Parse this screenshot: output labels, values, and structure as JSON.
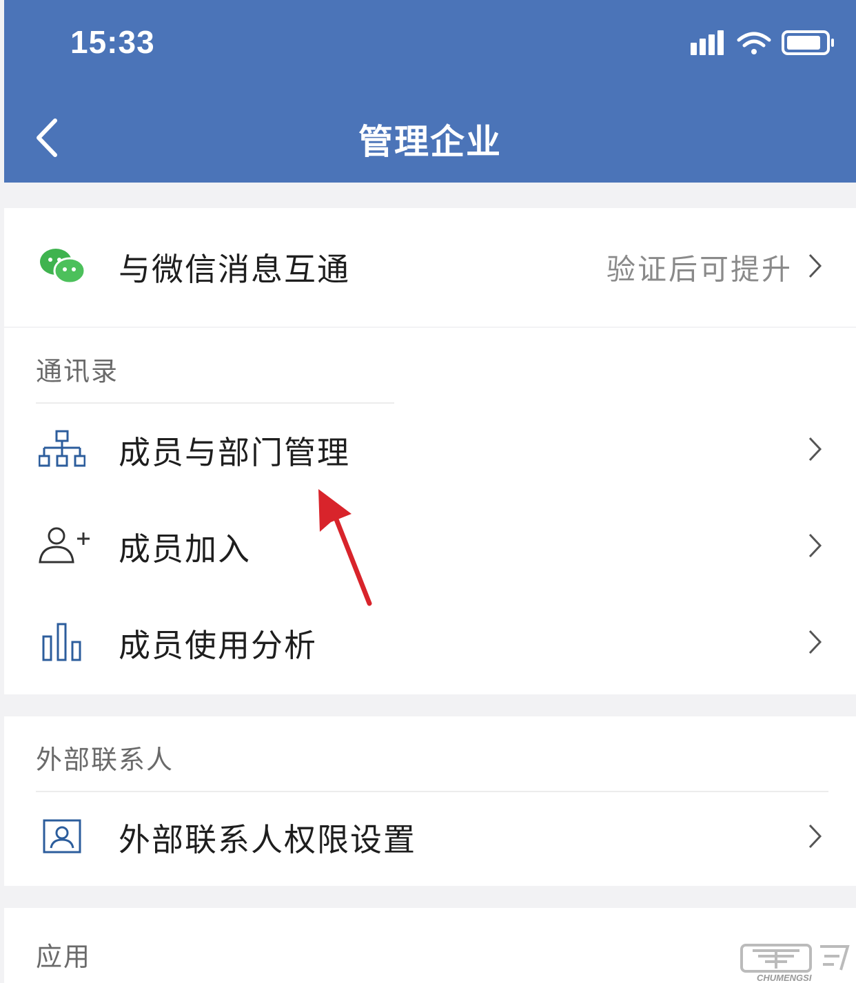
{
  "status_bar": {
    "time": "15:33"
  },
  "nav": {
    "title": "管理企业",
    "back_icon": "chevron-left-icon"
  },
  "wechat_row": {
    "label": "与微信消息互通",
    "value": "验证后可提升",
    "icon": "wechat-icon"
  },
  "sections": {
    "contacts": {
      "title": "通讯录",
      "items": [
        {
          "label": "成员与部门管理",
          "icon": "org-chart-icon"
        },
        {
          "label": "成员加入",
          "icon": "add-person-icon"
        },
        {
          "label": "成员使用分析",
          "icon": "bar-chart-icon"
        }
      ]
    },
    "external": {
      "title": "外部联系人",
      "items": [
        {
          "label": "外部联系人权限设置",
          "icon": "contact-card-icon"
        }
      ]
    },
    "apps": {
      "title": "应用"
    }
  },
  "watermark": {
    "text": "CHUMENGSI"
  },
  "colors": {
    "header": "#4b74b8",
    "wechat_green": "#3fb34f",
    "icon_blue": "#2c5d9c",
    "arrow_red": "#d8242b"
  }
}
